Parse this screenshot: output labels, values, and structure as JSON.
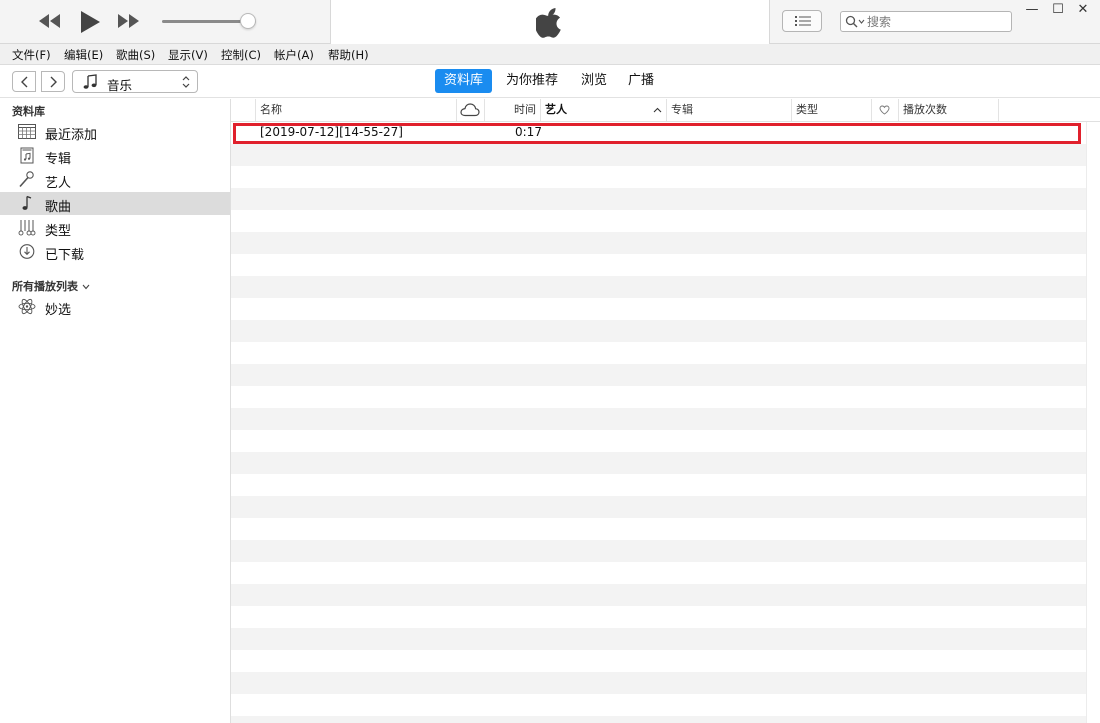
{
  "window": {
    "minimize_glyph": "—",
    "maximize_glyph": "☐",
    "close_glyph": "✕"
  },
  "player": {
    "volume_level": 0.92,
    "search": {
      "placeholder": "搜索",
      "value": ""
    }
  },
  "menu": {
    "items": [
      "文件(F)",
      "编辑(E)",
      "歌曲(S)",
      "显示(V)",
      "控制(C)",
      "帐户(A)",
      "帮助(H)"
    ]
  },
  "nav": {
    "media_kind": "音乐",
    "tabs": [
      {
        "label": "资料库",
        "active": true
      },
      {
        "label": "为你推荐",
        "active": false
      },
      {
        "label": "浏览",
        "active": false
      },
      {
        "label": "广播",
        "active": false
      }
    ]
  },
  "sidebar": {
    "library_heading": "资料库",
    "library_items": [
      {
        "label": "最近添加",
        "icon": "calendar-grid-icon",
        "selected": false
      },
      {
        "label": "专辑",
        "icon": "album-icon",
        "selected": false
      },
      {
        "label": "艺人",
        "icon": "microphone-icon",
        "selected": false
      },
      {
        "label": "歌曲",
        "icon": "music-note-icon",
        "selected": true
      },
      {
        "label": "类型",
        "icon": "genre-icon",
        "selected": false
      },
      {
        "label": "已下载",
        "icon": "download-clock-icon",
        "selected": false
      }
    ],
    "playlists_heading": "所有播放列表",
    "playlist_items": [
      {
        "label": "妙选",
        "icon": "genius-atom-icon"
      }
    ]
  },
  "table": {
    "columns": {
      "name": "名称",
      "time": "时间",
      "artist": "艺人",
      "album": "专辑",
      "genre": "类型",
      "plays": "播放次数"
    },
    "songs": [
      {
        "name": "[2019-07-12][14-55-27]",
        "time": "0:17",
        "artist": "",
        "album": "",
        "genre": "",
        "plays": ""
      }
    ]
  },
  "colors": {
    "accent": "#1a8cf0",
    "highlight_border": "#e0202c",
    "row_alt": "#f3f3f3"
  }
}
